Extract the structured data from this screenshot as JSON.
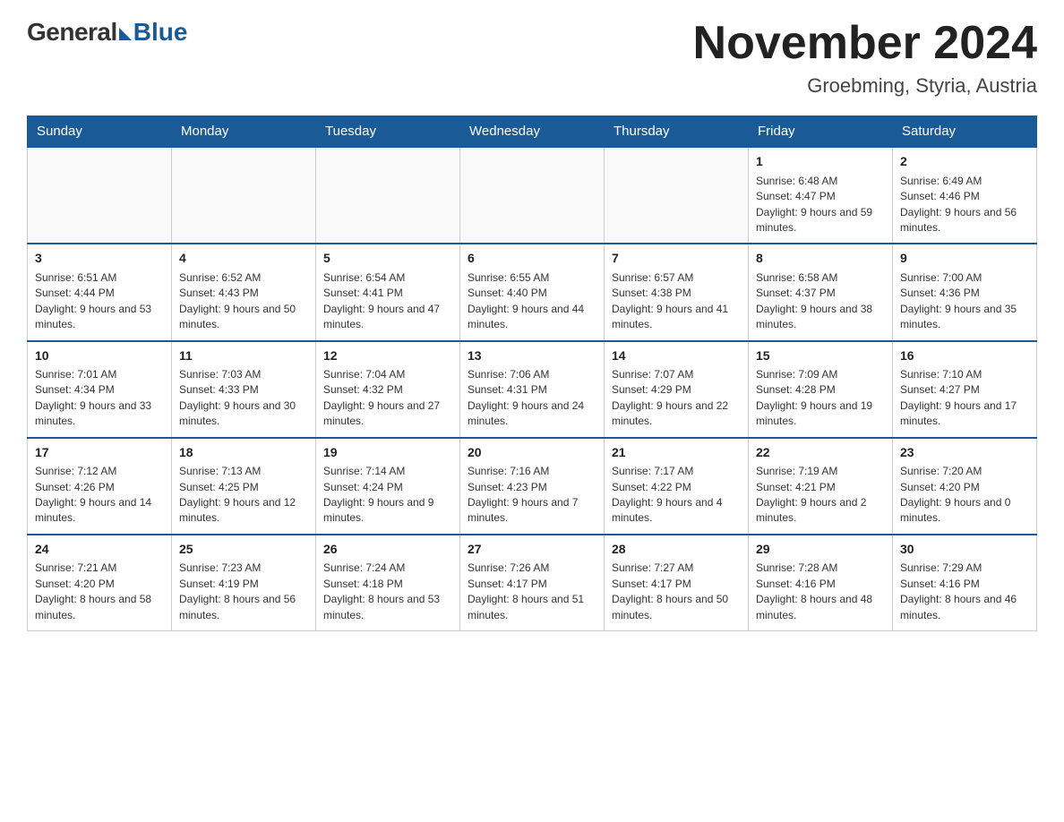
{
  "logo": {
    "general": "General",
    "blue": "Blue"
  },
  "header": {
    "month_year": "November 2024",
    "location": "Groebming, Styria, Austria"
  },
  "days_of_week": [
    "Sunday",
    "Monday",
    "Tuesday",
    "Wednesday",
    "Thursday",
    "Friday",
    "Saturday"
  ],
  "weeks": [
    {
      "days": [
        {
          "num": "",
          "info": ""
        },
        {
          "num": "",
          "info": ""
        },
        {
          "num": "",
          "info": ""
        },
        {
          "num": "",
          "info": ""
        },
        {
          "num": "",
          "info": ""
        },
        {
          "num": "1",
          "info": "Sunrise: 6:48 AM\nSunset: 4:47 PM\nDaylight: 9 hours and 59 minutes."
        },
        {
          "num": "2",
          "info": "Sunrise: 6:49 AM\nSunset: 4:46 PM\nDaylight: 9 hours and 56 minutes."
        }
      ]
    },
    {
      "days": [
        {
          "num": "3",
          "info": "Sunrise: 6:51 AM\nSunset: 4:44 PM\nDaylight: 9 hours and 53 minutes."
        },
        {
          "num": "4",
          "info": "Sunrise: 6:52 AM\nSunset: 4:43 PM\nDaylight: 9 hours and 50 minutes."
        },
        {
          "num": "5",
          "info": "Sunrise: 6:54 AM\nSunset: 4:41 PM\nDaylight: 9 hours and 47 minutes."
        },
        {
          "num": "6",
          "info": "Sunrise: 6:55 AM\nSunset: 4:40 PM\nDaylight: 9 hours and 44 minutes."
        },
        {
          "num": "7",
          "info": "Sunrise: 6:57 AM\nSunset: 4:38 PM\nDaylight: 9 hours and 41 minutes."
        },
        {
          "num": "8",
          "info": "Sunrise: 6:58 AM\nSunset: 4:37 PM\nDaylight: 9 hours and 38 minutes."
        },
        {
          "num": "9",
          "info": "Sunrise: 7:00 AM\nSunset: 4:36 PM\nDaylight: 9 hours and 35 minutes."
        }
      ]
    },
    {
      "days": [
        {
          "num": "10",
          "info": "Sunrise: 7:01 AM\nSunset: 4:34 PM\nDaylight: 9 hours and 33 minutes."
        },
        {
          "num": "11",
          "info": "Sunrise: 7:03 AM\nSunset: 4:33 PM\nDaylight: 9 hours and 30 minutes."
        },
        {
          "num": "12",
          "info": "Sunrise: 7:04 AM\nSunset: 4:32 PM\nDaylight: 9 hours and 27 minutes."
        },
        {
          "num": "13",
          "info": "Sunrise: 7:06 AM\nSunset: 4:31 PM\nDaylight: 9 hours and 24 minutes."
        },
        {
          "num": "14",
          "info": "Sunrise: 7:07 AM\nSunset: 4:29 PM\nDaylight: 9 hours and 22 minutes."
        },
        {
          "num": "15",
          "info": "Sunrise: 7:09 AM\nSunset: 4:28 PM\nDaylight: 9 hours and 19 minutes."
        },
        {
          "num": "16",
          "info": "Sunrise: 7:10 AM\nSunset: 4:27 PM\nDaylight: 9 hours and 17 minutes."
        }
      ]
    },
    {
      "days": [
        {
          "num": "17",
          "info": "Sunrise: 7:12 AM\nSunset: 4:26 PM\nDaylight: 9 hours and 14 minutes."
        },
        {
          "num": "18",
          "info": "Sunrise: 7:13 AM\nSunset: 4:25 PM\nDaylight: 9 hours and 12 minutes."
        },
        {
          "num": "19",
          "info": "Sunrise: 7:14 AM\nSunset: 4:24 PM\nDaylight: 9 hours and 9 minutes."
        },
        {
          "num": "20",
          "info": "Sunrise: 7:16 AM\nSunset: 4:23 PM\nDaylight: 9 hours and 7 minutes."
        },
        {
          "num": "21",
          "info": "Sunrise: 7:17 AM\nSunset: 4:22 PM\nDaylight: 9 hours and 4 minutes."
        },
        {
          "num": "22",
          "info": "Sunrise: 7:19 AM\nSunset: 4:21 PM\nDaylight: 9 hours and 2 minutes."
        },
        {
          "num": "23",
          "info": "Sunrise: 7:20 AM\nSunset: 4:20 PM\nDaylight: 9 hours and 0 minutes."
        }
      ]
    },
    {
      "days": [
        {
          "num": "24",
          "info": "Sunrise: 7:21 AM\nSunset: 4:20 PM\nDaylight: 8 hours and 58 minutes."
        },
        {
          "num": "25",
          "info": "Sunrise: 7:23 AM\nSunset: 4:19 PM\nDaylight: 8 hours and 56 minutes."
        },
        {
          "num": "26",
          "info": "Sunrise: 7:24 AM\nSunset: 4:18 PM\nDaylight: 8 hours and 53 minutes."
        },
        {
          "num": "27",
          "info": "Sunrise: 7:26 AM\nSunset: 4:17 PM\nDaylight: 8 hours and 51 minutes."
        },
        {
          "num": "28",
          "info": "Sunrise: 7:27 AM\nSunset: 4:17 PM\nDaylight: 8 hours and 50 minutes."
        },
        {
          "num": "29",
          "info": "Sunrise: 7:28 AM\nSunset: 4:16 PM\nDaylight: 8 hours and 48 minutes."
        },
        {
          "num": "30",
          "info": "Sunrise: 7:29 AM\nSunset: 4:16 PM\nDaylight: 8 hours and 46 minutes."
        }
      ]
    }
  ]
}
